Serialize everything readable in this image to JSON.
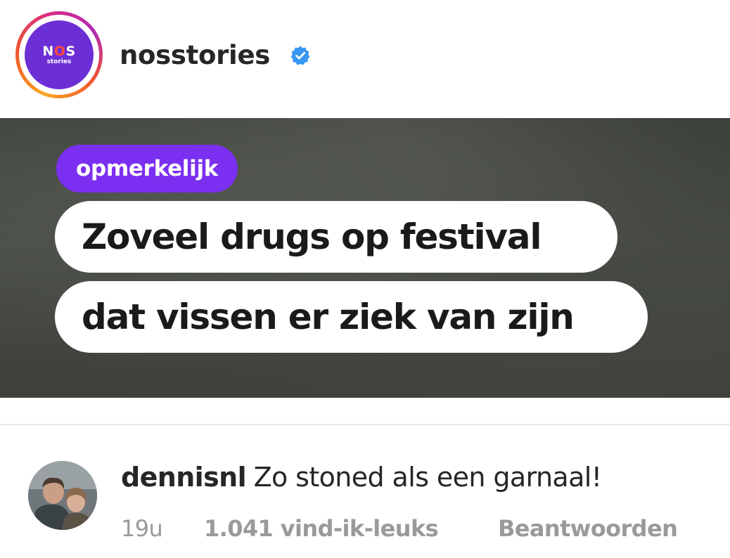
{
  "post": {
    "username": "nosstories",
    "verified_icon": "verified-badge-icon",
    "avatar": {
      "logo_main": "NOS",
      "logo_sub": "stories",
      "bg_color": "#6c2fd6",
      "accent_color": "#ff4a3d"
    }
  },
  "media": {
    "tag": "opmerkelijk",
    "tag_color": "#7b2ff0",
    "headline_line1": "Zoveel drugs op festival",
    "headline_line2": "dat vissen er ziek van zijn"
  },
  "comment": {
    "username": "dennisnl",
    "text": "Zo stoned als een garnaal!",
    "time": "19u",
    "likes": "1.041 vind-ik-leuks",
    "reply_label": "Beantwoorden"
  }
}
